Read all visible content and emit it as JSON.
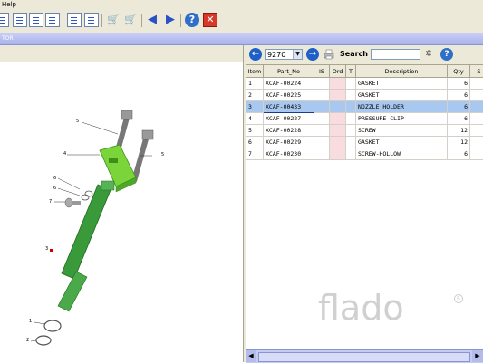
{
  "menubar": {
    "help_label": "Help"
  },
  "window": {
    "title_fragment": "TOR"
  },
  "toolbar": {
    "buttons": [
      "document-icon",
      "checklist-icon",
      "sort-icon",
      "dropdown-icon",
      "search-key-icon",
      "key-icon",
      "cart-add-icon",
      "cart-remove-icon",
      "back-arrow-icon",
      "forward-arrow-icon",
      "help-icon",
      "close-icon"
    ]
  },
  "parts_toolbar": {
    "catalog_value": "9270",
    "search_label": "Search",
    "search_value": ""
  },
  "parts_table": {
    "columns": [
      "Item",
      "Part_No",
      "IS",
      "Ord",
      "T",
      "Description",
      "Qty",
      "S"
    ],
    "rows": [
      {
        "item": "1",
        "part_no": "XCAF-00224",
        "is": "",
        "ord": "",
        "t": "",
        "description": "GASKET",
        "qty": "6"
      },
      {
        "item": "2",
        "part_no": "XCAF-00225",
        "is": "",
        "ord": "",
        "t": "",
        "description": "GASKET",
        "qty": "6"
      },
      {
        "item": "3",
        "part_no": "XCAF-00433",
        "is": "",
        "ord": "",
        "t": "",
        "description": "NOZZLE HOLDER",
        "qty": "6"
      },
      {
        "item": "4",
        "part_no": "XCAF-00227",
        "is": "",
        "ord": "",
        "t": "",
        "description": "PRESSURE CLIP",
        "qty": "6"
      },
      {
        "item": "5",
        "part_no": "XCAF-00228",
        "is": "",
        "ord": "",
        "t": "",
        "description": "SCREW",
        "qty": "12"
      },
      {
        "item": "6",
        "part_no": "XCAF-00229",
        "is": "",
        "ord": "",
        "t": "",
        "description": "GASKET",
        "qty": "12"
      },
      {
        "item": "7",
        "part_no": "XCAF-00230",
        "is": "",
        "ord": "",
        "t": "",
        "description": "SCREW-HOLLOW",
        "qty": "6"
      }
    ],
    "selected_item": "3"
  },
  "diagram": {
    "callouts": [
      "5",
      "4",
      "5",
      "6",
      "6",
      "7",
      "3",
      "1",
      "2"
    ]
  },
  "watermark": {
    "text": "flado",
    "mark": "R"
  },
  "colors": {
    "title_bar": "#a9b2ec",
    "selected_row": "#a8c8f0",
    "pink_column": "#f8dce0",
    "part_green": "#3a9a3a",
    "clip_green": "#7ad43a"
  }
}
